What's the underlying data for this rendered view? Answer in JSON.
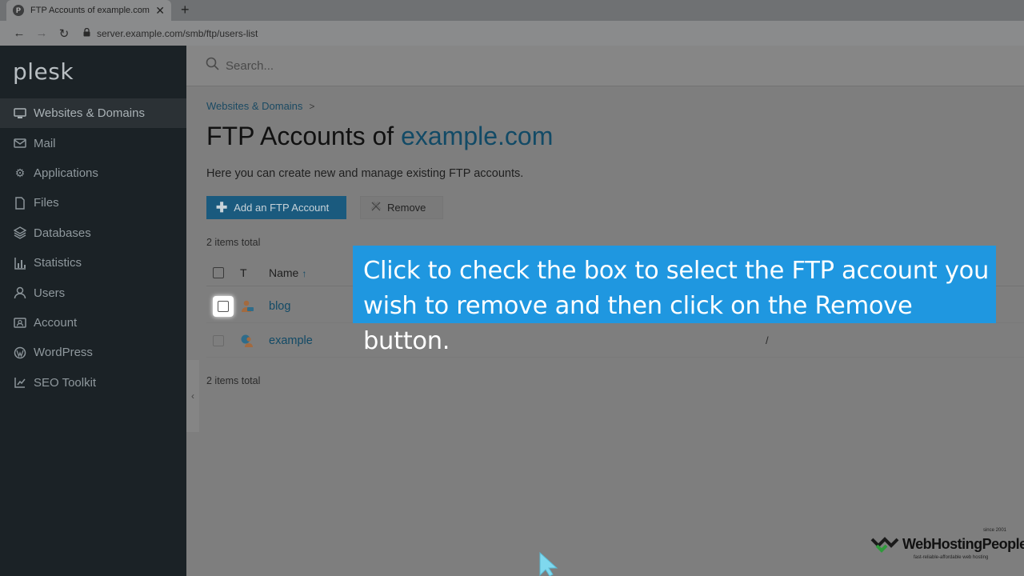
{
  "browser": {
    "tab_title": "FTP Accounts of example.com - ",
    "tab_favicon": "P",
    "url": "server.example.com/smb/ftp/users-list"
  },
  "sidebar": {
    "logo": "plesk",
    "items": [
      {
        "label": "Websites & Domains",
        "icon": "monitor-icon",
        "active": true
      },
      {
        "label": "Mail",
        "icon": "mail-icon"
      },
      {
        "label": "Applications",
        "icon": "gear-icon"
      },
      {
        "label": "Files",
        "icon": "file-icon"
      },
      {
        "label": "Databases",
        "icon": "layers-icon"
      },
      {
        "label": "Statistics",
        "icon": "bar-chart-icon"
      },
      {
        "label": "Users",
        "icon": "user-icon"
      },
      {
        "label": "Account",
        "icon": "id-card-icon"
      },
      {
        "label": "WordPress",
        "icon": "wordpress-icon"
      },
      {
        "label": "SEO Toolkit",
        "icon": "external-chart-icon"
      }
    ]
  },
  "search": {
    "placeholder": "Search..."
  },
  "breadcrumb": {
    "item": "Websites & Domains",
    "sep": ">"
  },
  "page": {
    "title_prefix": "FTP Accounts of ",
    "title_domain": "example.com",
    "description": "Here you can create new and manage existing FTP accounts."
  },
  "toolbar": {
    "add_label": "Add an FTP Account",
    "remove_label": "Remove"
  },
  "list": {
    "items_total": "2 items total",
    "columns": {
      "type": "T",
      "name": "Name",
      "sort": "↑"
    },
    "rows": [
      {
        "name": "blog",
        "home": "",
        "highlighted": true
      },
      {
        "name": "example",
        "home": "/",
        "highlighted": false
      }
    ]
  },
  "tooltip": {
    "line1": "Click to check the box to select the FTP account you",
    "line2": "wish to remove and then click on the Remove button."
  },
  "watermark": {
    "name": "WebHostingPeople",
    "since": "since 2001",
    "tagline": "fast-reliable-affordable web hosting"
  }
}
